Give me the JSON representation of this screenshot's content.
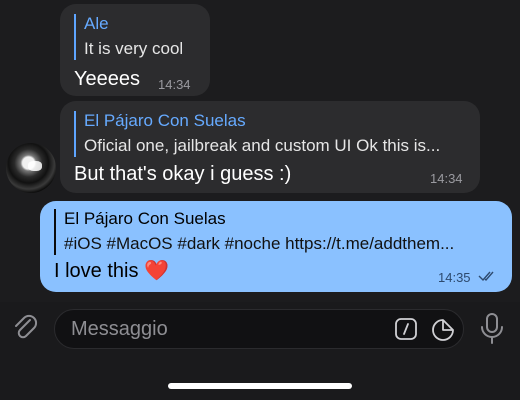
{
  "messages": [
    {
      "reply_name": "Ale",
      "reply_text": "It is very cool",
      "text": "Yeeees",
      "time": "14:34"
    },
    {
      "reply_name": "El Pájaro Con Suelas",
      "reply_text": "Oficial one, jailbreak and custom UI Ok this is...",
      "text": "But that's okay i guess :)",
      "time": "14:34"
    },
    {
      "reply_name": "El Pájaro Con Suelas",
      "reply_text": "#iOS #MacOS #dark #noche https://t.me/addthem...",
      "text": "I love this ❤️",
      "time": "14:35"
    }
  ],
  "composer": {
    "placeholder": "Messaggio"
  },
  "icons": {
    "attach": "paperclip-icon",
    "commands": "slash-command-icon",
    "sticker": "sticker-icon",
    "mic": "microphone-icon",
    "read": "double-check-icon"
  },
  "colors": {
    "outgoing_bubble": "#8ac1ff",
    "incoming_bubble": "#2c2c2e",
    "reply_accent": "#5ea5ff",
    "background": "#1c1c1e"
  }
}
